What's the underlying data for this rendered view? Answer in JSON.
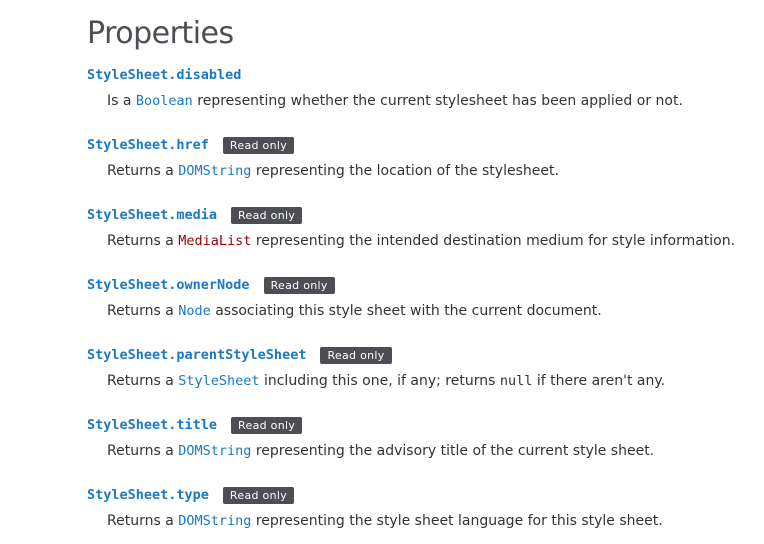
{
  "section": {
    "title": "Properties"
  },
  "badge_label": "Read only",
  "properties": [
    {
      "name": "StyleSheet.disabled",
      "read_only": false,
      "desc_before": "Is a ",
      "type_link": "Boolean",
      "type_missing": false,
      "desc_after": " representing whether the current stylesheet has been applied or not."
    },
    {
      "name": "StyleSheet.href",
      "read_only": true,
      "desc_before": "Returns a ",
      "type_link": "DOMString",
      "type_missing": false,
      "desc_after": " representing the location of the stylesheet."
    },
    {
      "name": "StyleSheet.media",
      "read_only": true,
      "desc_before": "Returns a ",
      "type_link": "MediaList",
      "type_missing": true,
      "desc_after": " representing the intended destination medium for style information."
    },
    {
      "name": "StyleSheet.ownerNode",
      "read_only": true,
      "desc_before": "Returns a ",
      "type_link": "Node",
      "type_missing": false,
      "desc_after": " associating this style sheet with the current document."
    },
    {
      "name": "StyleSheet.parentStyleSheet",
      "read_only": true,
      "desc_before": "Returns a ",
      "type_link": "StyleSheet",
      "type_missing": false,
      "desc_middle": " including this one, if any; returns ",
      "desc_code": "null",
      "desc_after": " if there aren't any."
    },
    {
      "name": "StyleSheet.title",
      "read_only": true,
      "desc_before": "Returns a ",
      "type_link": "DOMString",
      "type_missing": false,
      "desc_after": " representing the advisory title of the current style sheet."
    },
    {
      "name": "StyleSheet.type",
      "read_only": true,
      "desc_before": "Returns a ",
      "type_link": "DOMString",
      "type_missing": false,
      "desc_after": " representing the style sheet language for this style sheet."
    }
  ],
  "colors": {
    "link": "#1a79c2",
    "missing_link": "#990000",
    "badge_bg": "#4d4e53",
    "text": "#333333"
  }
}
